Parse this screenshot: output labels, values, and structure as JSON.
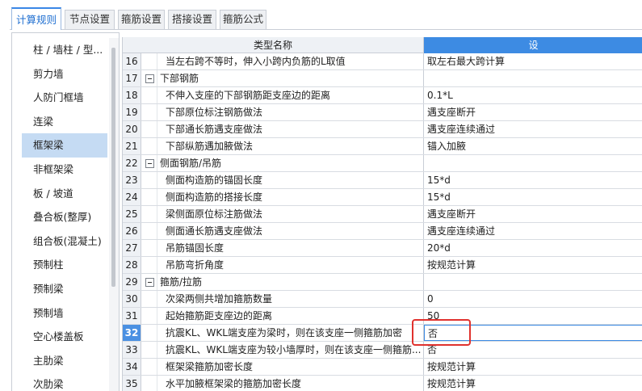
{
  "tabs": [
    {
      "label": "计算规则",
      "active": true
    },
    {
      "label": "节点设置",
      "active": false
    },
    {
      "label": "箍筋设置",
      "active": false
    },
    {
      "label": "搭接设置",
      "active": false
    },
    {
      "label": "箍筋公式",
      "active": false
    }
  ],
  "sidebar": {
    "items": [
      {
        "label": "柱 / 墙柱 / 型..."
      },
      {
        "label": "剪力墙"
      },
      {
        "label": "人防门框墙"
      },
      {
        "label": "连梁"
      },
      {
        "label": "框架梁",
        "selected": true
      },
      {
        "label": "非框架梁"
      },
      {
        "label": "板 / 坡道"
      },
      {
        "label": "叠合板(整厚)"
      },
      {
        "label": "组合板(混凝土)"
      },
      {
        "label": "预制柱"
      },
      {
        "label": "预制梁"
      },
      {
        "label": "预制墙"
      },
      {
        "label": "空心楼盖板"
      },
      {
        "label": "主肋梁"
      },
      {
        "label": "次肋梁"
      }
    ]
  },
  "grid": {
    "header": {
      "name": "类型名称",
      "value": "设"
    },
    "rows": [
      {
        "num": "16",
        "name": "当左右跨不等时，伸入小跨内负筋的L取值",
        "value": "取左右最大跨计算",
        "type": "item"
      },
      {
        "num": "17",
        "name": "下部钢筋",
        "value": "",
        "type": "group"
      },
      {
        "num": "18",
        "name": "不伸入支座的下部钢筋距支座边的距离",
        "value": "0.1*L",
        "type": "item"
      },
      {
        "num": "19",
        "name": "下部原位标注钢筋做法",
        "value": "遇支座断开",
        "type": "item"
      },
      {
        "num": "20",
        "name": "下部通长筋遇支座做法",
        "value": "遇支座连续通过",
        "type": "item"
      },
      {
        "num": "21",
        "name": "下部纵筋遇加腋做法",
        "value": "锚入加腋",
        "type": "item"
      },
      {
        "num": "22",
        "name": "侧面钢筋/吊筋",
        "value": "",
        "type": "group"
      },
      {
        "num": "23",
        "name": "侧面构造筋的锚固长度",
        "value": "15*d",
        "type": "item"
      },
      {
        "num": "24",
        "name": "侧面构造筋的搭接长度",
        "value": "15*d",
        "type": "item"
      },
      {
        "num": "25",
        "name": "梁侧面原位标注筋做法",
        "value": "遇支座断开",
        "type": "item"
      },
      {
        "num": "26",
        "name": "侧面通长筋遇支座做法",
        "value": "遇支座连续通过",
        "type": "item"
      },
      {
        "num": "27",
        "name": "吊筋锚固长度",
        "value": "20*d",
        "type": "item"
      },
      {
        "num": "28",
        "name": "吊筋弯折角度",
        "value": "按规范计算",
        "type": "item"
      },
      {
        "num": "29",
        "name": "箍筋/拉筋",
        "value": "",
        "type": "group"
      },
      {
        "num": "30",
        "name": "次梁两侧共增加箍筋数量",
        "value": "0",
        "type": "item"
      },
      {
        "num": "31",
        "name": "起始箍筋距支座边的距离",
        "value": "50",
        "type": "item"
      },
      {
        "num": "32",
        "name": "抗震KL、WKL端支座为梁时，则在该支座一侧箍筋加密",
        "value": "否",
        "type": "item",
        "current": true
      },
      {
        "num": "33",
        "name": "抗震KL、WKL端支座为较小墙厚时，则在该支座一侧箍筋...",
        "value": "否",
        "type": "item"
      },
      {
        "num": "34",
        "name": "框架梁箍筋加密长度",
        "value": "按规范计算",
        "type": "item"
      },
      {
        "num": "35",
        "name": "水平加腋框架梁的箍筋加密长度",
        "value": "按规范计算",
        "type": "item"
      }
    ]
  },
  "colors": {
    "accent": "#3d8be3",
    "selected_bg": "#c5dbf3",
    "highlight": "#e0322e"
  }
}
